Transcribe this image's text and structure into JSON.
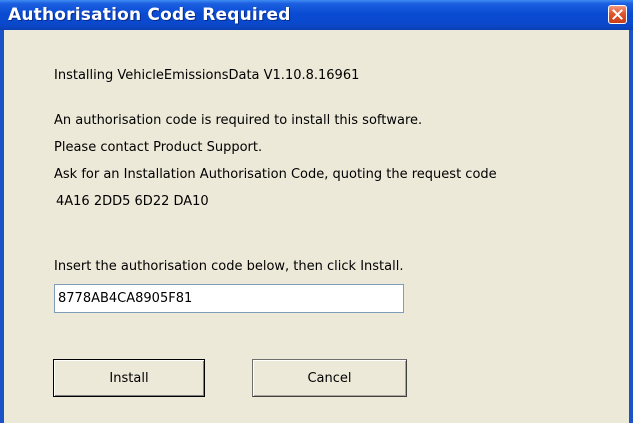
{
  "window": {
    "title": "Authorisation Code Required"
  },
  "message": {
    "installing": "Installing VehicleEmissionsData V1.10.8.16961",
    "line1": "An authorisation code is required to install this software.",
    "line2": "Please contact Product Support.",
    "line3": "Ask for an Installation Authorisation Code, quoting the request code",
    "request_code": "4A16 2DD5 6D22 DA10",
    "instruction": "Insert the authorisation code below, then click Install."
  },
  "code_field": {
    "value": "8778AB4CA8905F81"
  },
  "buttons": {
    "install_label": "Install",
    "cancel_label": "Cancel"
  },
  "icons": {
    "close": "close-icon"
  },
  "colors": {
    "titlebar": "#0a4bd3",
    "client_background": "#ece9d8",
    "close_button": "#e2542d"
  }
}
